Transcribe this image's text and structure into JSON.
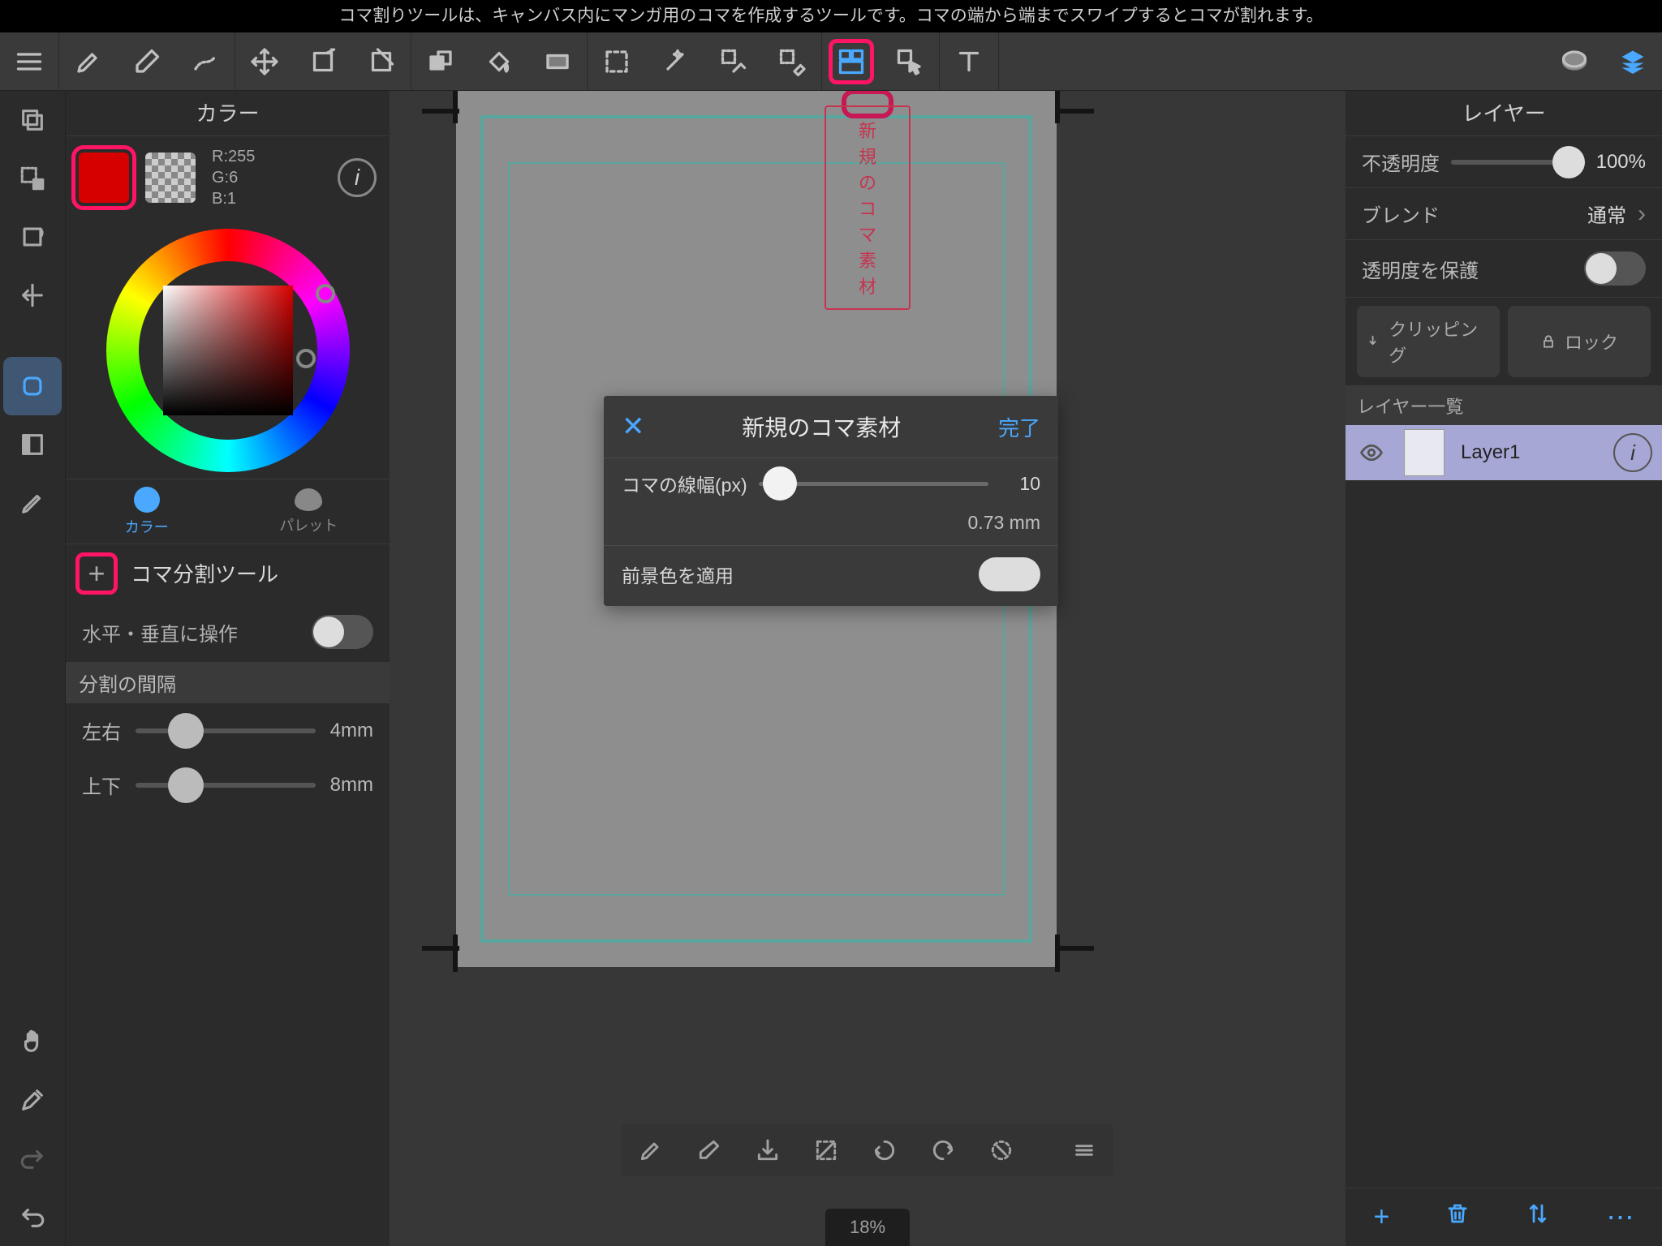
{
  "hint": "コマ割りツールは、キャンバス内にマンガ用のコマを作成するツールです。コマの端から端までスワイプするとコマが割れます。",
  "leftPanel": {
    "colorTitle": "カラー",
    "rgb": {
      "r": "R:255",
      "g": "G:6",
      "b": "B:1"
    },
    "tabs": {
      "color": "カラー",
      "palette": "パレット"
    },
    "toolTitle": "コマ分割ツール",
    "hvLabel": "水平・垂直に操作",
    "gapHeader": "分割の間隔",
    "lr": {
      "label": "左右",
      "value": "4mm"
    },
    "tb": {
      "label": "上下",
      "value": "8mm"
    }
  },
  "canvas": {
    "newFrameBtn": "新規のコマ素材",
    "zoom": "18%"
  },
  "modal": {
    "title": "新規のコマ素材",
    "done": "完了",
    "lineWidthLabel": "コマの線幅(px)",
    "lineWidthVal": "10",
    "mm": "0.73 mm",
    "applyFg": "前景色を適用"
  },
  "rightPanel": {
    "title": "レイヤー",
    "opacity": {
      "label": "不透明度",
      "value": "100%"
    },
    "blend": {
      "label": "ブレンド",
      "value": "通常"
    },
    "protect": "透明度を保護",
    "clip": "クリッピング",
    "lock": "ロック",
    "listHeader": "レイヤー一覧",
    "layer1": "Layer1"
  }
}
